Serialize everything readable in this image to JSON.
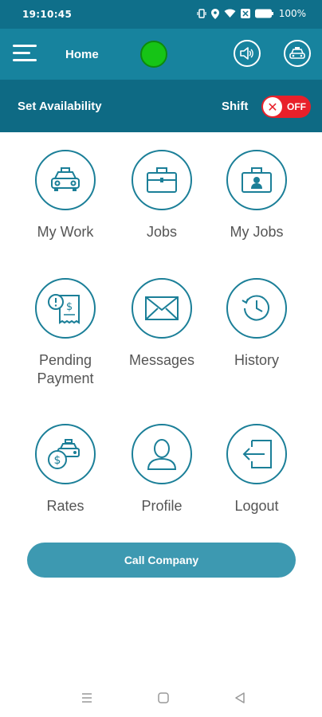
{
  "status_bar": {
    "time": "19:10:45",
    "battery": "100%"
  },
  "appbar": {
    "title": "Home"
  },
  "availability": {
    "label": "Set Availability",
    "shift_label": "Shift",
    "toggle_state": "OFF",
    "toggle_x": "✕"
  },
  "menu": {
    "my_work": "My Work",
    "jobs": "Jobs",
    "my_jobs": "My Jobs",
    "pending_payment_line1": "Pending",
    "pending_payment_line2": "Payment",
    "messages": "Messages",
    "history": "History",
    "rates": "Rates",
    "profile": "Profile",
    "logout": "Logout"
  },
  "call_button": "Call Company",
  "colors": {
    "primary": "#17839e",
    "dark": "#0e6a84",
    "status_online": "#16c416",
    "toggle_off": "#e8202a",
    "button": "#3d99b1"
  }
}
